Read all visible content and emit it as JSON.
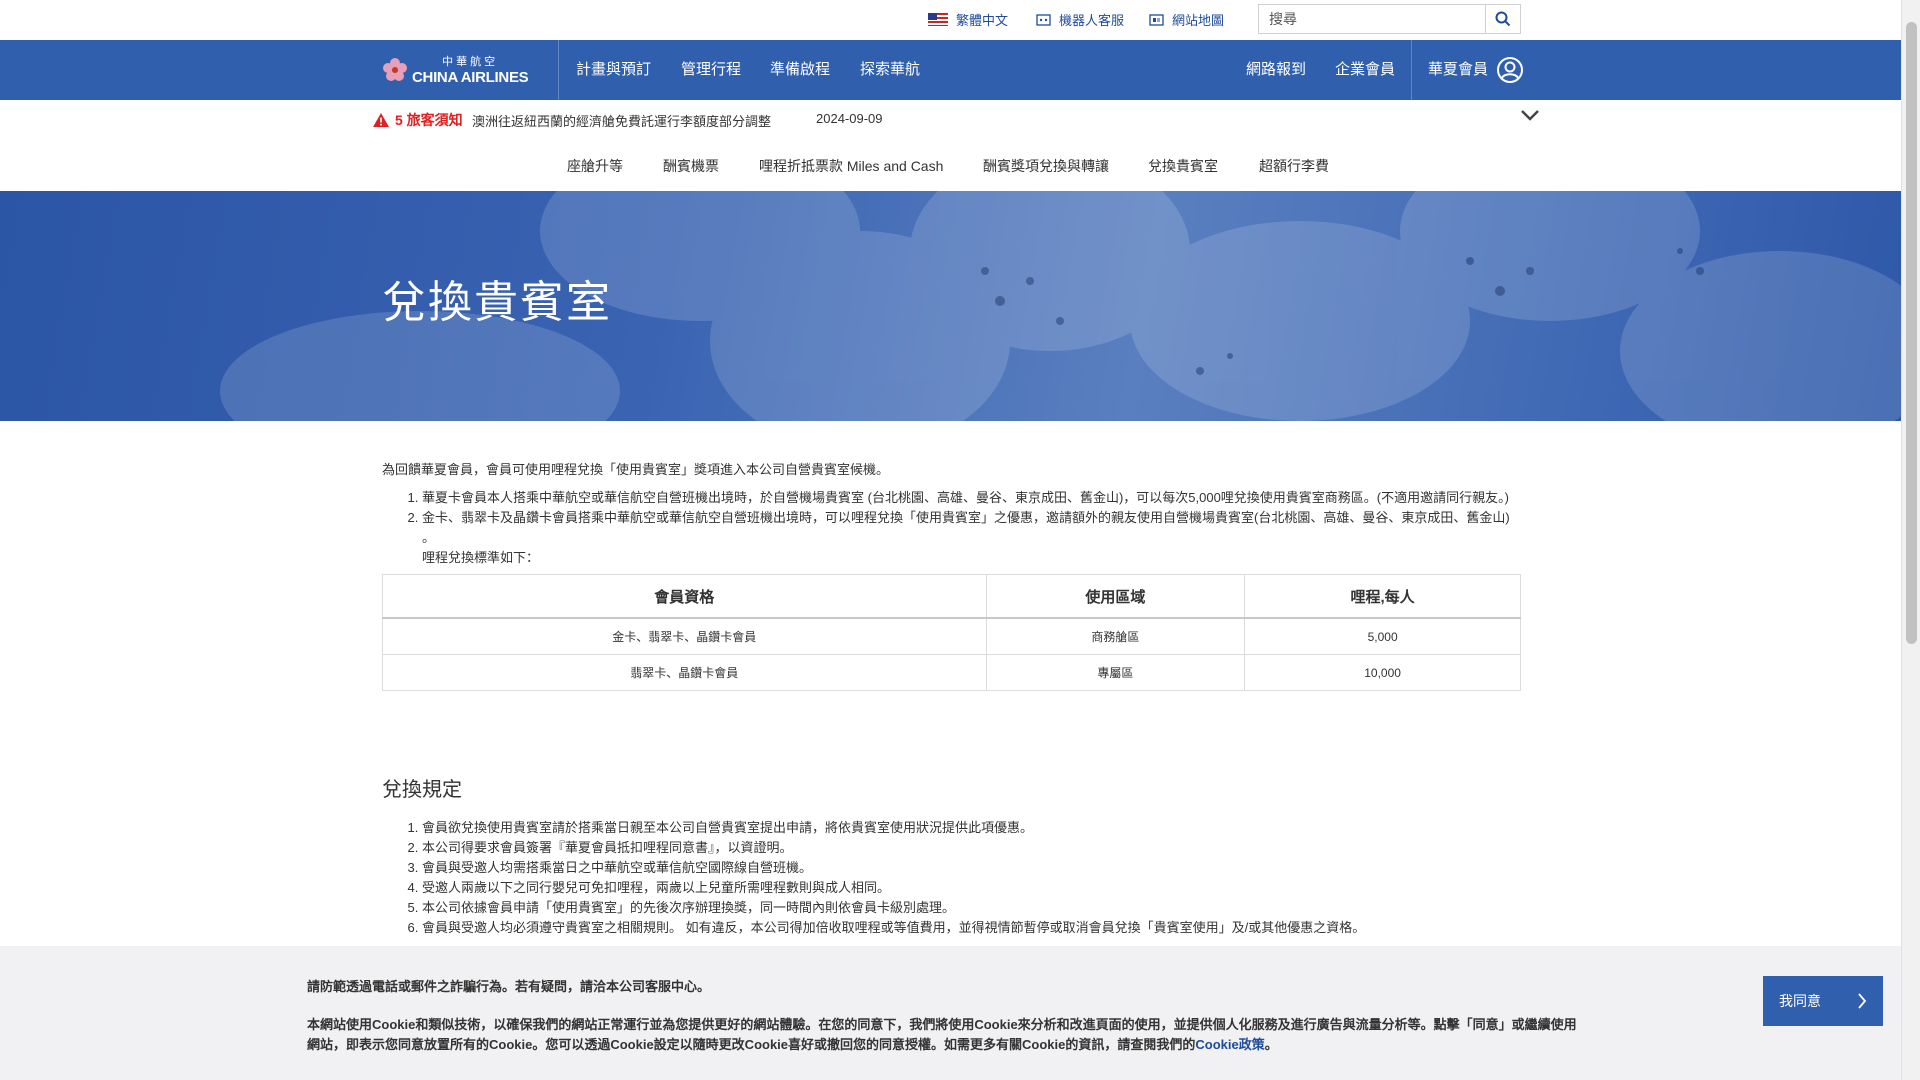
{
  "utility": {
    "language": "繁體中文",
    "chatbot": "機器人客服",
    "sitemap": "網站地圖",
    "search_placeholder": "搜尋"
  },
  "brand": {
    "cn": "中華航空",
    "en": "CHINA AIRLINES"
  },
  "nav": {
    "items": [
      "計畫與預訂",
      "管理行程",
      "準備啟程",
      "探索華航"
    ],
    "checkin": "網路報到",
    "corporate": "企業會員",
    "member": "華夏會員"
  },
  "notice": {
    "label": "5 旅客須知",
    "text": "澳洲往返紐西蘭的經濟艙免費託運行李額度部分調整",
    "date": "2024-09-09"
  },
  "subnav": [
    "座艙升等",
    "酬賓機票",
    "哩程折抵票款 Miles and Cash",
    "酬賓獎項兌換與轉讓",
    "兌換貴賓室",
    "超額行李費"
  ],
  "hero": {
    "title": "兌換貴賓室"
  },
  "content": {
    "intro": "為回饋華夏會員，會員可使用哩程兌換「使用貴賓室」獎項進入本公司自營貴賓室候機。",
    "items": [
      "華夏卡會員本人搭乘中華航空或華信航空自營班機出境時，於自營機場貴賓室 (台北桃園、高雄、曼谷、東京成田、舊金山)，可以每次5,000哩兌換使用貴賓室商務區。(不適用邀請同行親友。)",
      "金卡、翡翠卡及晶鑽卡會員搭乘中華航空或華信航空自營班機出境時，可以哩程兌換「使用貴賓室」之優惠，邀請額外的親友使用自營機場貴賓室(台北桃園、高雄、曼谷、東京成田、舊金山) 。"
    ],
    "rate_title": "哩程兌換標準如下：",
    "table": {
      "headers": [
        "會員資格",
        "使用區域",
        "哩程,每人"
      ],
      "rows": [
        [
          "金卡、翡翠卡、晶鑽卡會員",
          "商務艙區",
          "5,000"
        ],
        [
          "翡翠卡、晶鑽卡會員",
          "專屬區",
          "10,000"
        ]
      ]
    }
  },
  "rules": {
    "heading": "兌換規定",
    "items": [
      "會員欲兌換使用貴賓室請於搭乘當日親至本公司自營貴賓室提出申請，將依貴賓室使用狀況提供此項優惠。",
      "本公司得要求會員簽署『華夏會員抵扣哩程同意書』，以資證明。",
      "會員與受邀人均需搭乘當日之中華航空或華信航空國際線自營班機。",
      "受邀人兩歲以下之同行嬰兒可免扣哩程，兩歲以上兒童所需哩程數則與成人相同。",
      "本公司依據會員申請「使用貴賓室」的先後次序辦理換獎，同一時間內則依會員卡級別處理。",
      "會員與受邀人均必須遵守貴賓室之相關規則。 如有違反，本公司得加倍收取哩程或等值費用，並得視情節暫停或取消會員兌換「貴賓室使用」及/或其他優惠之資格。"
    ]
  },
  "cookie": {
    "warning": "請防範透過電話或郵件之詐騙行為。若有疑問，請洽本公司客服中心。",
    "text": "本網站使用Cookie和類似技術，以確保我們的網站正常運行並為您提供更好的網站體驗。在您的同意下，我們將使用Cookie來分析和改進頁面的使用，並提供個人化服務及進行廣告與流量分析等。點擊「同意」或繼續使用網站，即表示您同意放置所有的Cookie。您可以透過Cookie設定以隨時更改Cookie喜好或撤回您的同意授權。如需更多有關Cookie的資訊，請查閱我們的",
    "link": "Cookie政策",
    "tail": "。",
    "agree": "我同意"
  },
  "colors": {
    "brand_blue": "#2f5fad",
    "alert_red": "#d22222",
    "link_blue": "#1f4b9b"
  }
}
